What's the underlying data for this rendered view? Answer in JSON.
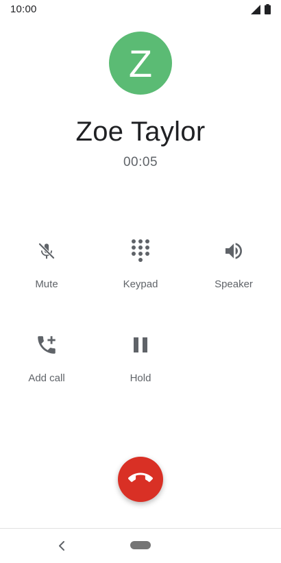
{
  "status_bar": {
    "time": "10:00",
    "signal_icon": "cell-signal-icon",
    "battery_icon": "battery-icon"
  },
  "contact": {
    "initial": "Z",
    "name": "Zoe Taylor",
    "avatar_color": "#5bbb74"
  },
  "call": {
    "timer": "00:05"
  },
  "controls": [
    {
      "label": "Mute",
      "icon": "mic-off-icon"
    },
    {
      "label": "Keypad",
      "icon": "dialpad-icon"
    },
    {
      "label": "Speaker",
      "icon": "speaker-icon"
    },
    {
      "label": "Add call",
      "icon": "add-call-icon"
    },
    {
      "label": "Hold",
      "icon": "pause-icon"
    }
  ],
  "end_call": {
    "icon": "call-end-icon",
    "color": "#d93025"
  },
  "nav": {
    "back_icon": "back-chevron-icon",
    "home_icon": "home-pill-icon"
  },
  "colors": {
    "icon": "#5f6368",
    "text_primary": "#202124",
    "text_secondary": "#5f6368"
  }
}
